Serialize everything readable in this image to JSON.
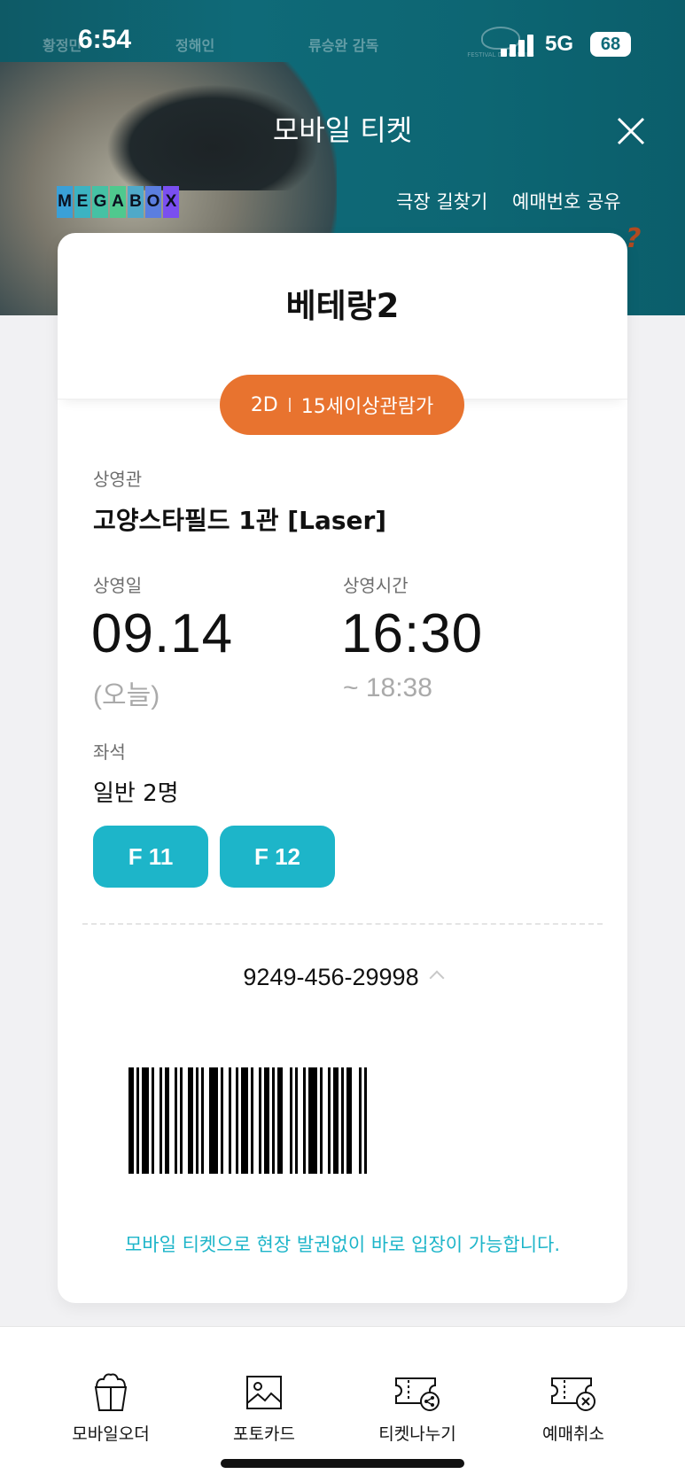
{
  "status_bar": {
    "time": "6:54",
    "network": "5G",
    "battery": "68"
  },
  "poster": {
    "credits": [
      "황정민",
      "정해인",
      "류승완 감독"
    ],
    "festival_text": "FESTIVAL DE CANNES"
  },
  "header": {
    "title": "모바일 티켓",
    "brand": [
      "M",
      "E",
      "G",
      "A",
      "B",
      "O",
      "X"
    ],
    "links": [
      "극장 길찾기",
      "예매번호 공유"
    ]
  },
  "ticket": {
    "movie_title": "베테랑2",
    "format": "2D",
    "rating": "15세이상관람가",
    "theater_label": "상영관",
    "theater_value": "고양스타필드 1관 [Laser]",
    "date_label": "상영일",
    "date_value": "09.14",
    "date_note": "(오늘)",
    "time_label": "상영시간",
    "time_value": "16:30",
    "time_end": "~  18:38",
    "seat_label": "좌석",
    "seat_count": "일반 2명",
    "seats": [
      "F 11",
      "F 12"
    ],
    "booking_number": "9249-456-29998",
    "notice": "모바일 티켓으로 현장 발권없이 바로 입장이 가능합니다."
  },
  "bottom_bar": {
    "items": [
      {
        "label": "모바일오더",
        "icon": "popcorn-icon"
      },
      {
        "label": "포토카드",
        "icon": "photo-icon"
      },
      {
        "label": "티켓나누기",
        "icon": "ticket-share-icon"
      },
      {
        "label": "예매취소",
        "icon": "ticket-cancel-icon"
      }
    ]
  },
  "colors": {
    "accent_teal": "#1db5c9",
    "badge_orange": "#e8732f",
    "hero_bg": "#0f6a78"
  }
}
